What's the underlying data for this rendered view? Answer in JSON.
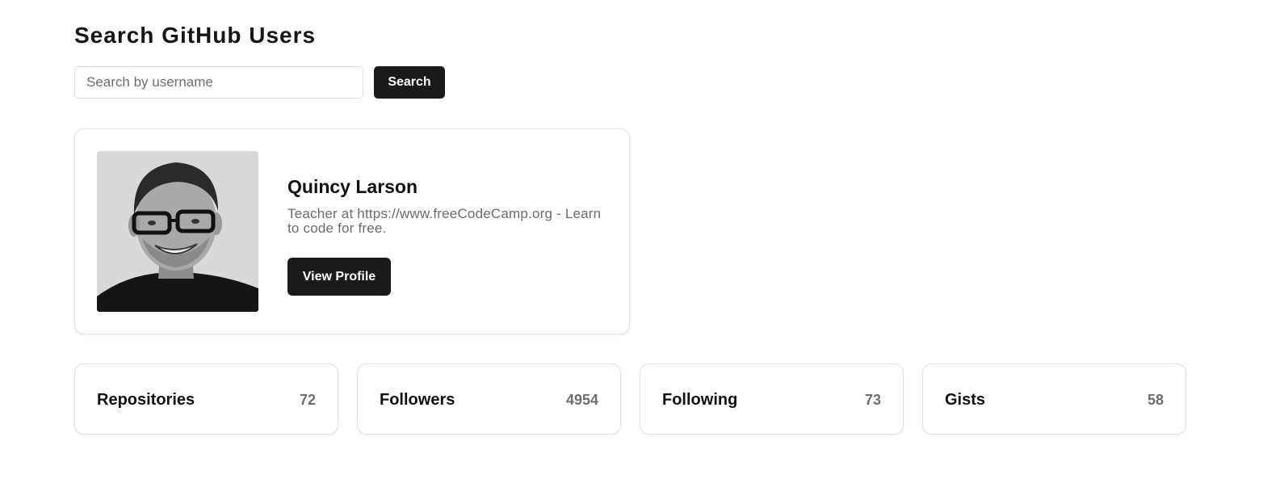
{
  "header": {
    "title": "Search GitHub Users"
  },
  "search": {
    "placeholder": "Search by username",
    "value": "",
    "button_label": "Search"
  },
  "profile": {
    "name": "Quincy Larson",
    "bio": "Teacher at https://www.freeCodeCamp.org - Learn to code for free.",
    "view_profile_label": "View Profile",
    "avatar_alt": "avatar"
  },
  "stats": [
    {
      "label": "Repositories",
      "value": "72"
    },
    {
      "label": "Followers",
      "value": "4954"
    },
    {
      "label": "Following",
      "value": "73"
    },
    {
      "label": "Gists",
      "value": "58"
    }
  ],
  "colors": {
    "button_background": "#1a1a1a",
    "button_text": "#ffffff",
    "muted_text": "#6b6b6b",
    "card_border": "#e2e2e2"
  }
}
